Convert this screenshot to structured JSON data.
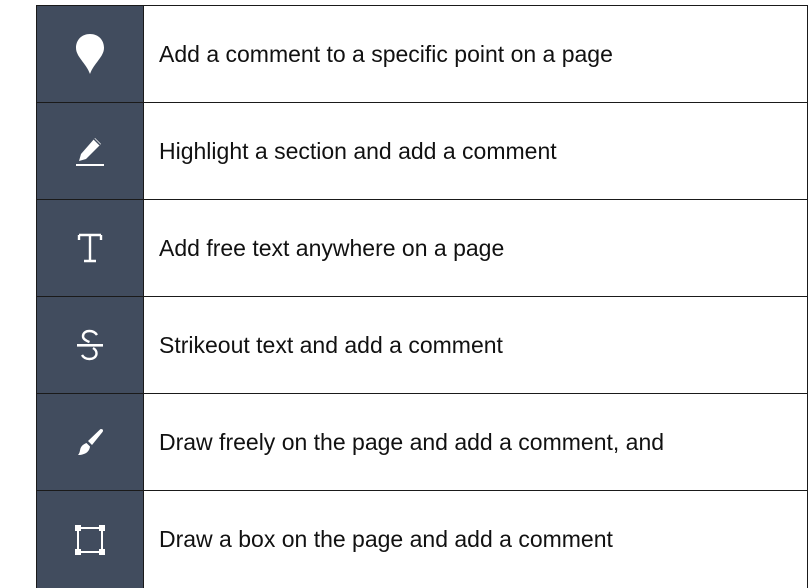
{
  "tools": [
    {
      "icon": "comment-pin-icon",
      "description": "Add a comment to a specific point on a page"
    },
    {
      "icon": "highlight-pen-icon",
      "description": "Highlight a section and add a comment"
    },
    {
      "icon": "text-t-icon",
      "description": "Add free text anywhere on a page"
    },
    {
      "icon": "strikeout-s-icon",
      "description": "Strikeout text and add a comment"
    },
    {
      "icon": "paintbrush-icon",
      "description": "Draw freely on the page and add a comment, and"
    },
    {
      "icon": "box-rectangle-icon",
      "description": "Draw a box on the page and add a comment"
    }
  ],
  "colors": {
    "icon_background": "#414c5e",
    "icon_foreground": "#ffffff",
    "text": "#111111",
    "border": "#1a1a1a"
  }
}
